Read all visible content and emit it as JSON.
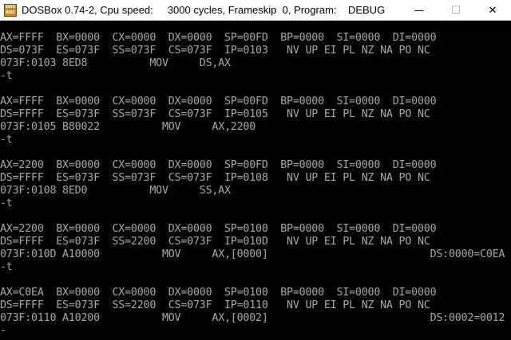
{
  "window": {
    "title": "DOSBox 0.74-2, Cpu speed:     3000 cycles, Frameskip  0, Program:    DEBUG",
    "icon_text": "DOS BOX",
    "controls": {
      "minimize": "—",
      "maximize": "☐",
      "close": "✕"
    }
  },
  "console": {
    "lines": [
      "AX=FFFF  BX=0000  CX=0000  DX=0000  SP=00FD  BP=0000  SI=0000  DI=0000",
      "DS=073F  ES=073F  SS=073F  CS=073F  IP=0103   NV UP EI PL NZ NA PO NC",
      "073F:0103 8ED8          MOV     DS,AX",
      "-t",
      "",
      "AX=FFFF  BX=0000  CX=0000  DX=0000  SP=00FD  BP=0000  SI=0000  DI=0000",
      "DS=FFFF  ES=073F  SS=073F  CS=073F  IP=0105   NV UP EI PL NZ NA PO NC",
      "073F:0105 B80022          MOV     AX,2200",
      "-t",
      "",
      "AX=2200  BX=0000  CX=0000  DX=0000  SP=00FD  BP=0000  SI=0000  DI=0000",
      "DS=FFFF  ES=073F  SS=073F  CS=073F  IP=0108   NV UP EI PL NZ NA PO NC",
      "073F:0108 8ED0          MOV     SS,AX",
      "-t",
      "",
      "AX=2200  BX=0000  CX=0000  DX=0000  SP=0100  BP=0000  SI=0000  DI=0000",
      "DS=FFFF  ES=073F  SS=2200  CS=073F  IP=010D   NV UP EI PL NZ NA PO NC",
      "073F:010D A10000          MOV     AX,[0000]                          DS:0000=C0EA",
      "-t",
      "",
      "AX=C0EA  BX=0000  CX=0000  DX=0000  SP=0100  BP=0000  SI=0000  DI=0000",
      "DS=FFFF  ES=073F  SS=2200  CS=073F  IP=0110   NV UP EI PL NZ NA PO NC",
      "073F:0110 A10200          MOV     AX,[0002]                          DS:0002=0012"
    ],
    "prompt": "-"
  }
}
